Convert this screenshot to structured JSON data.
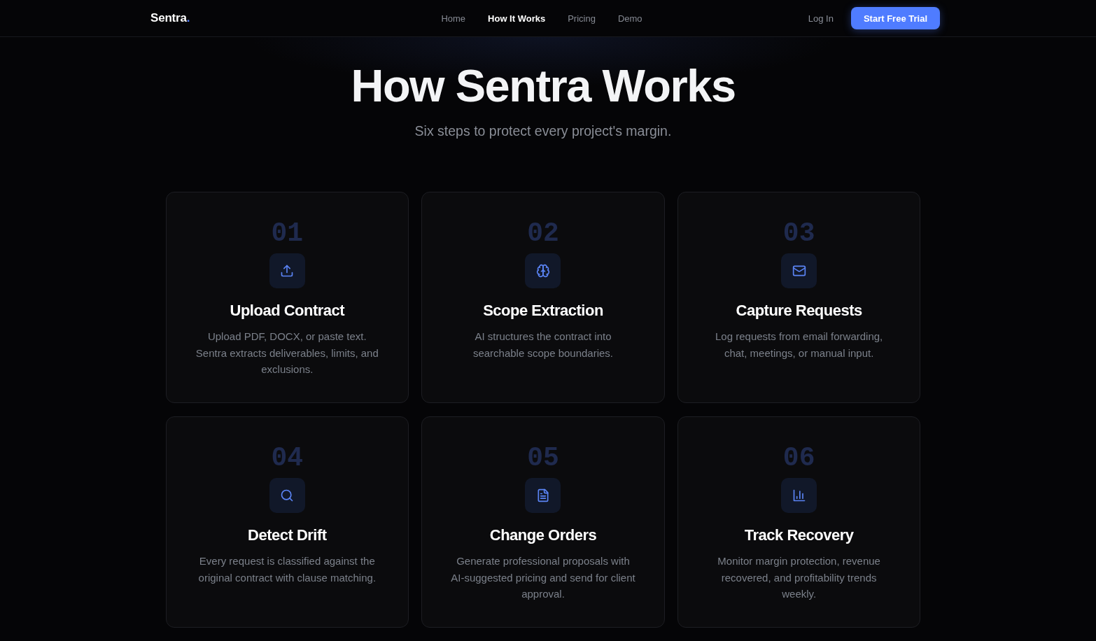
{
  "header": {
    "logo": {
      "text": "Sentra",
      "accent": "."
    },
    "nav": [
      {
        "label": "Home",
        "selected": false
      },
      {
        "label": "How It Works",
        "selected": true
      },
      {
        "label": "Pricing",
        "selected": false
      },
      {
        "label": "Demo",
        "selected": false
      }
    ],
    "login": "Log In",
    "cta": "Start Free Trial"
  },
  "hero": {
    "title": "How Sentra Works",
    "subtitle": "Six steps to protect every project's margin."
  },
  "steps": [
    {
      "number": "01",
      "title": "Upload Contract",
      "description": "Upload PDF, DOCX, or paste text. Sentra extracts deliverables, limits, and exclusions."
    },
    {
      "number": "02",
      "title": "Scope Extraction",
      "description": "AI structures the contract into searchable scope boundaries."
    },
    {
      "number": "03",
      "title": "Capture Requests",
      "description": "Log requests from email forwarding, chat, meetings, or manual input."
    },
    {
      "number": "04",
      "title": "Detect Drift",
      "description": "Every request is classified against the original contract with clause matching."
    },
    {
      "number": "05",
      "title": "Change Orders",
      "description": "Generate professional proposals with AI-suggested pricing and send for client approval."
    },
    {
      "number": "06",
      "title": "Track Recovery",
      "description": "Monitor margin protection, revenue recovered, and profitability trends weekly."
    }
  ]
}
